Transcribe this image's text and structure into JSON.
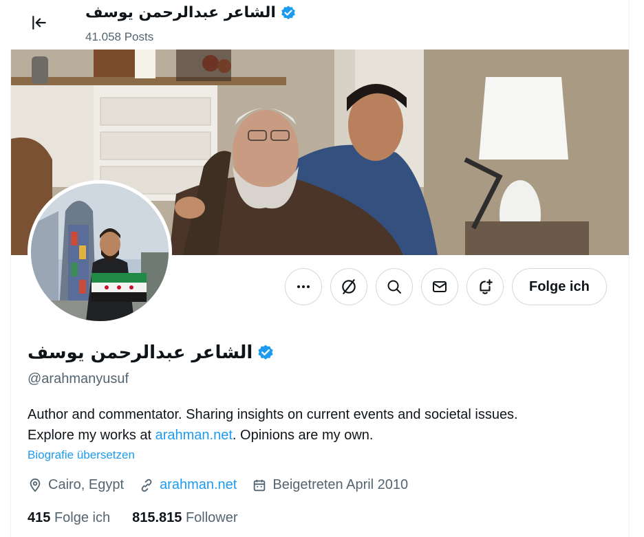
{
  "header": {
    "name": "الشاعر عبدالرحمن يوسف",
    "posts": "41.058 Posts"
  },
  "actions": {
    "follow_label": "Folge ich"
  },
  "profile": {
    "name": "الشاعر عبدالرحمن يوسف",
    "handle": "@arahmanyusuf",
    "bio_line1": "Author and commentator. Sharing insights on current events and societal issues.",
    "bio_line2_pre": "Explore my works at ",
    "bio_link": "arahman.net",
    "bio_line2_post": ". Opinions are my own.",
    "translate": "Biografie übersetzen",
    "location": "Cairo, Egypt",
    "website": "arahman.net",
    "joined": "Beigetreten April 2010"
  },
  "stats": {
    "following_count": "415",
    "following_label": "Folge ich",
    "followers_count": "815.815",
    "followers_label": "Follower"
  },
  "colors": {
    "accent": "#1d9bf0",
    "verified": "#1d9bf0",
    "muted": "#536471",
    "border": "#cfd9de"
  },
  "icons": [
    "back-arrow-icon",
    "verified-badge-icon",
    "more-icon",
    "grok-icon",
    "search-icon",
    "message-icon",
    "notify-bell-icon",
    "location-icon",
    "link-icon",
    "calendar-icon"
  ]
}
